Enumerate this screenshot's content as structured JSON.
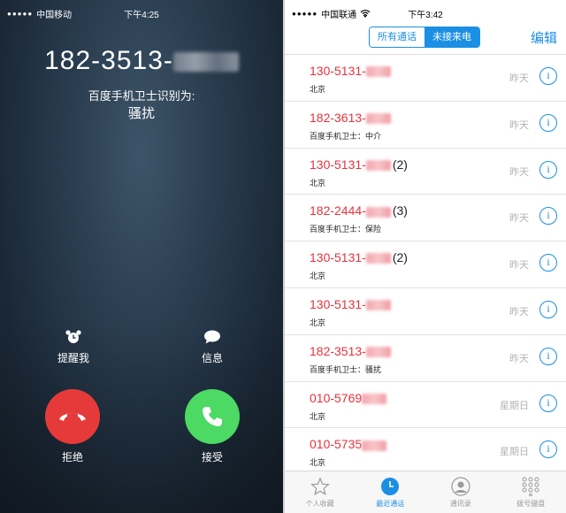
{
  "left": {
    "status": {
      "signal": "●●●●●",
      "carrier": "中国移动",
      "time": "下午4:25"
    },
    "caller": {
      "number_prefix": "182-3513-",
      "label": "百度手机卫士识别为:",
      "tag": "骚扰"
    },
    "actions": {
      "remind": "提醒我",
      "message": "信息",
      "decline": "拒绝",
      "accept": "接受"
    }
  },
  "right": {
    "status": {
      "signal": "●●●●●",
      "carrier": "中国联通",
      "time": "下午3:42"
    },
    "segment": {
      "all": "所有通话",
      "missed": "未接来电"
    },
    "edit": "编辑",
    "calls": [
      {
        "number": "130-5131-",
        "count": "",
        "location": "北京",
        "when": "昨天"
      },
      {
        "number": "182-3613-",
        "count": "",
        "location": "百度手机卫士：中介",
        "when": "昨天"
      },
      {
        "number": "130-5131-",
        "count": "(2)",
        "location": "北京",
        "when": "昨天"
      },
      {
        "number": "182-2444-",
        "count": "(3)",
        "location": "百度手机卫士：保险",
        "when": "昨天"
      },
      {
        "number": "130-5131-",
        "count": "(2)",
        "location": "北京",
        "when": "昨天"
      },
      {
        "number": "130-5131-",
        "count": "",
        "location": "北京",
        "when": "昨天"
      },
      {
        "number": "182-3513-",
        "count": "",
        "location": "百度手机卫士：骚扰",
        "when": "昨天"
      },
      {
        "number": "010-5769",
        "count": "",
        "location": "北京",
        "when": "星期日"
      },
      {
        "number": "010-5735",
        "count": "",
        "location": "北京",
        "when": "星期日"
      }
    ],
    "info_glyph": "i",
    "tabs": [
      {
        "label": "个人收藏",
        "icon": "star-icon"
      },
      {
        "label": "最近通话",
        "icon": "clock-icon"
      },
      {
        "label": "通讯录",
        "icon": "contact-icon"
      },
      {
        "label": "拨号键盘",
        "icon": "keypad-icon"
      }
    ]
  },
  "colors": {
    "accent": "#1a8fe3",
    "decline": "#e63a3a",
    "accept": "#4cd964",
    "missed": "#e8313d"
  }
}
